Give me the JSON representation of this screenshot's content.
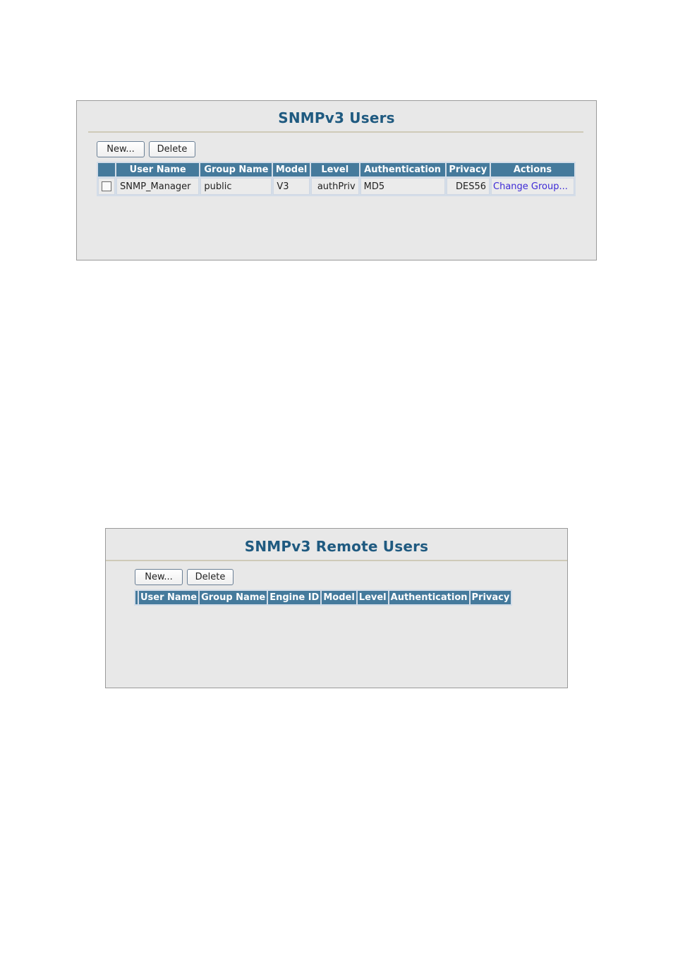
{
  "snmpv3_users": {
    "title": "SNMPv3 Users",
    "buttons": {
      "new": "New...",
      "delete": "Delete"
    },
    "columns": [
      "",
      "User Name",
      "Group Name",
      "Model",
      "Level",
      "Authentication",
      "Privacy",
      "Actions"
    ],
    "rows": [
      {
        "user_name": "SNMP_Manager",
        "group_name": "public",
        "model": "V3",
        "level": "authPriv",
        "authentication": "MD5",
        "privacy": "DES56",
        "action": "Change Group...",
        "checked": false
      }
    ]
  },
  "snmpv3_remote_users": {
    "title": "SNMPv3 Remote Users",
    "buttons": {
      "new": "New...",
      "delete": "Delete"
    },
    "columns": [
      "",
      "User Name",
      "Group Name",
      "Engine ID",
      "Model",
      "Level",
      "Authentication",
      "Privacy"
    ],
    "rows": []
  },
  "colors": {
    "title": "#1f5a80",
    "header_bg": "#457a9c",
    "link": "#3d2ad6",
    "panel_bg": "#e8e8e8"
  }
}
